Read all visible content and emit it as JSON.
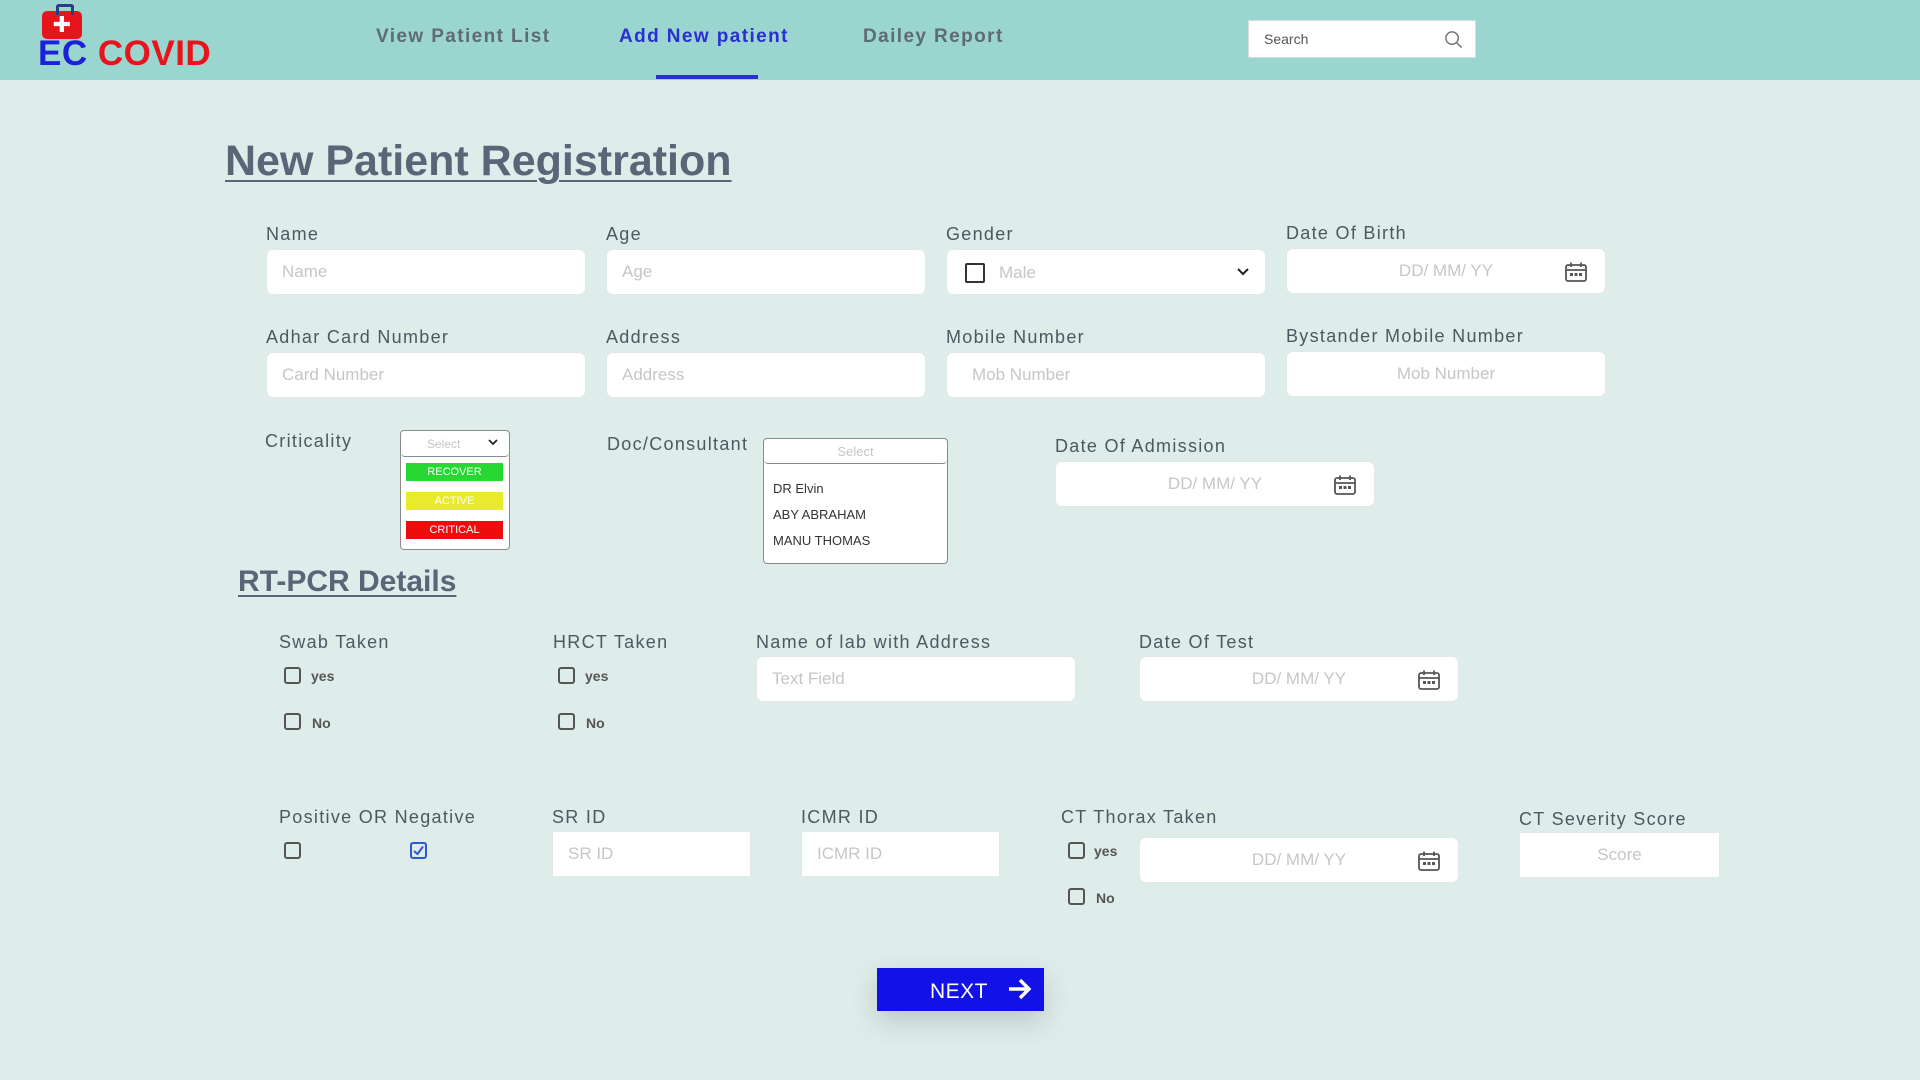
{
  "app": {
    "logo_ec": "EC",
    "logo_covid": "COVID"
  },
  "nav": {
    "items": [
      "View Patient List",
      "Add New patient",
      "Dailey Report"
    ],
    "active_index": 1
  },
  "search": {
    "placeholder": "Search"
  },
  "page_title": "New Patient Registration",
  "personal": {
    "name": {
      "label": "Name",
      "placeholder": "Name"
    },
    "age": {
      "label": "Age",
      "placeholder": "Age"
    },
    "gender": {
      "label": "Gender",
      "value": "Male"
    },
    "dob": {
      "label": "Date Of Birth",
      "placeholder": "DD/ MM/ YY"
    },
    "adhar": {
      "label": "Adhar Card Number",
      "placeholder": "Card Number"
    },
    "address": {
      "label": "Address",
      "placeholder": "Address"
    },
    "mobile": {
      "label": "Mobile Number",
      "placeholder": "Mob Number"
    },
    "bystander": {
      "label": "Bystander Mobile Number",
      "placeholder": "Mob Number"
    },
    "criticality": {
      "label": "Criticality",
      "placeholder": "Select",
      "options": [
        {
          "label": "RECOVER",
          "color": "#27d833"
        },
        {
          "label": "ACTIVE",
          "color": "#eaea2c"
        },
        {
          "label": "CRITICAL",
          "color": "#ee0d0d"
        }
      ]
    },
    "doctor": {
      "label": "Doc/Consultant",
      "placeholder": "Select",
      "options": [
        "DR Elvin",
        "ABY ABRAHAM",
        "MANU THOMAS"
      ]
    },
    "admission": {
      "label": "Date Of Admission",
      "placeholder": "DD/ MM/ YY"
    }
  },
  "rtpcr": {
    "title": "RT-PCR Details",
    "swab": {
      "label": "Swab Taken",
      "yes": "yes",
      "no": "No"
    },
    "hrct": {
      "label": "HRCT Taken",
      "yes": "yes",
      "no": "No"
    },
    "lab": {
      "label": "Name of lab with Address",
      "placeholder": "Text Field"
    },
    "test_date": {
      "label": "Date Of Test",
      "placeholder": "DD/ MM/ YY"
    },
    "result": {
      "label": "Positive OR Negative",
      "positive_checked": false,
      "negative_checked": true
    },
    "sr_id": {
      "label": "SR ID",
      "placeholder": "SR ID"
    },
    "icmr_id": {
      "label": "ICMR ID",
      "placeholder": "ICMR ID"
    },
    "ct_thorax": {
      "label": "CT Thorax Taken",
      "yes": "yes",
      "no": "No",
      "date_placeholder": "DD/ MM/ YY"
    },
    "ct_score": {
      "label": "CT Severity Score",
      "placeholder": "Score"
    }
  },
  "next_button": {
    "label": "NEXT"
  },
  "colors": {
    "accent": "#2b2fd2",
    "topbar": "#9bd5cf",
    "background": "#deecea",
    "button": "#1212e6",
    "logo_red": "#e8141b",
    "logo_blue": "#1b21d6"
  }
}
